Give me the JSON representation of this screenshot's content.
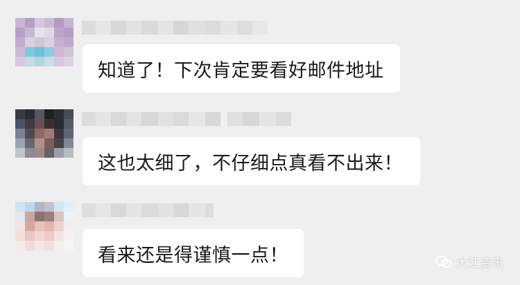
{
  "messages": [
    {
      "text": "知道了！下次肯定要看好邮件地址"
    },
    {
      "text": "这也太细了，不仔细点真看不出来！"
    },
    {
      "text": "看来还是得谨慎一点！"
    }
  ],
  "watermark": {
    "label": "大江资讯",
    "icon": "wechat-icon"
  },
  "colors": {
    "background": "#efefef",
    "bubble": "#ffffff",
    "text": "#191919"
  }
}
